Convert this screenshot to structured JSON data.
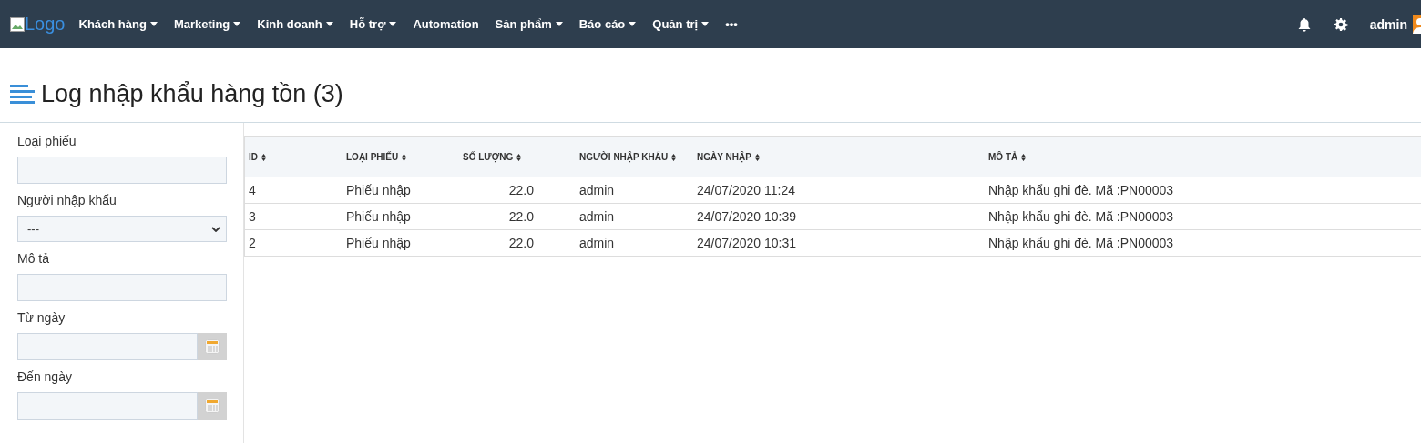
{
  "navbar": {
    "logo_alt": "Logo",
    "menu": [
      {
        "label": "Khách hàng",
        "dropdown": true
      },
      {
        "label": "Marketing",
        "dropdown": true
      },
      {
        "label": "Kinh doanh",
        "dropdown": true
      },
      {
        "label": "Hỗ trợ",
        "dropdown": true
      },
      {
        "label": "Automation",
        "dropdown": false
      },
      {
        "label": "Sản phẩm",
        "dropdown": true
      },
      {
        "label": "Báo cáo",
        "dropdown": true
      },
      {
        "label": "Quản trị",
        "dropdown": true
      },
      {
        "label": "•••",
        "dropdown": false
      }
    ],
    "user": "admin"
  },
  "page_title": "Log nhập khẩu hàng tồn (3)",
  "filters": [
    {
      "label": "Loại phiếu",
      "kind": "text"
    },
    {
      "label": "Người nhập khẩu",
      "kind": "select",
      "value": "---"
    },
    {
      "label": "Mô tả",
      "kind": "text"
    },
    {
      "label": "Từ ngày",
      "kind": "date"
    },
    {
      "label": "Đến ngày",
      "kind": "date"
    }
  ],
  "table": {
    "columns": [
      "ID",
      "LOẠI PHIẾU",
      "SỐ LƯỢNG",
      "NGƯỜI NHẬP KHẨU",
      "NGÀY NHẬP",
      "MÔ TẢ"
    ],
    "rows": [
      [
        "4",
        "Phiếu nhập",
        "22.0",
        "admin",
        "24/07/2020 11:24",
        "Nhập khẩu ghi đè. Mã :PN00003"
      ],
      [
        "3",
        "Phiếu nhập",
        "22.0",
        "admin",
        "24/07/2020 10:39",
        "Nhập khẩu ghi đè. Mã :PN00003"
      ],
      [
        "2",
        "Phiếu nhập",
        "22.0",
        "admin",
        "24/07/2020 10:31",
        "Nhập khẩu ghi đè. Mã :PN00003"
      ]
    ]
  }
}
